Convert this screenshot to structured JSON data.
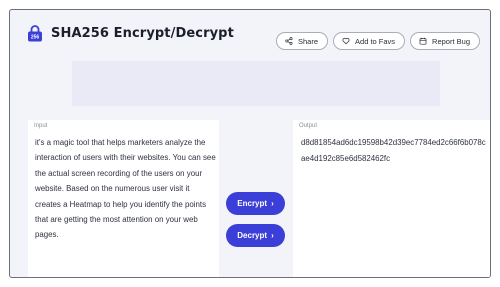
{
  "header": {
    "title": "SHA256 Encrypt/Decrypt",
    "logo_text": "256",
    "accent_color": "#3b3fd8"
  },
  "actions": [
    {
      "label": "Share",
      "icon": "share-icon"
    },
    {
      "label": "Add to Favs",
      "icon": "heart-icon"
    },
    {
      "label": "Report Bug",
      "icon": "bug-icon"
    }
  ],
  "input": {
    "label": "Input",
    "value": "it's a magic tool that helps marketers analyze the interaction of users with their websites. You can see the actual screen recording of the users on your website. Based on the numerous user visit it creates a Heatmap to help you identify the points that are getting the most attention on your web pages."
  },
  "output": {
    "label": "Output",
    "value": "d8d81854ad6dc19598b42d39ec7784ed2c66f6b078cae4d192c85e6d582462fc"
  },
  "buttons": {
    "encrypt": "Encrypt",
    "decrypt": "Decrypt"
  }
}
